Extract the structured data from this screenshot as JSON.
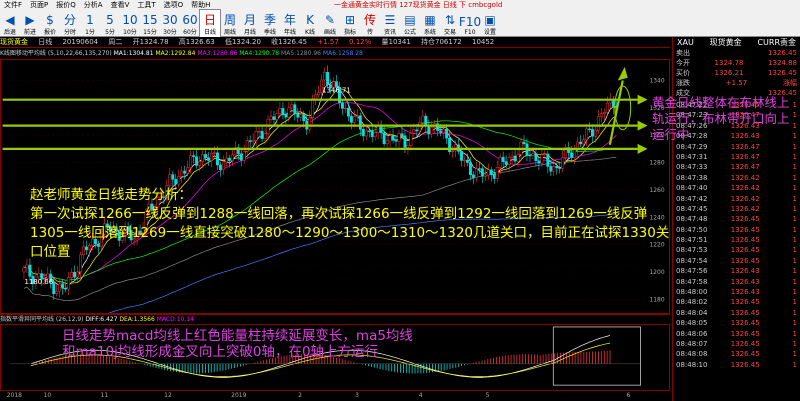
{
  "menu": [
    "文件F",
    "页面P",
    "报价Q",
    "分析A",
    "查看V",
    "工具T",
    "选项O",
    "帮助H"
  ],
  "window_title": "一金通黄金实时行情 127现货黄金 日线 下 cmbcgold",
  "toolbar": [
    {
      "glyph": "◀",
      "label": "后退"
    },
    {
      "glyph": "▶",
      "label": "前进"
    },
    {
      "glyph": "$",
      "label": "报价"
    },
    {
      "glyph": "分",
      "label": "分时"
    },
    {
      "glyph": "1",
      "label": "1分"
    },
    {
      "glyph": "5",
      "label": "5分"
    },
    {
      "glyph": "10",
      "label": "10分"
    },
    {
      "glyph": "15",
      "label": "15分"
    },
    {
      "glyph": "30",
      "label": "30分"
    },
    {
      "glyph": "60",
      "label": "60分"
    },
    {
      "glyph": "日",
      "label": "日线"
    },
    {
      "glyph": "周",
      "label": "周线"
    },
    {
      "glyph": "月",
      "label": "月线"
    },
    {
      "glyph": "季",
      "label": "季线"
    },
    {
      "glyph": "年",
      "label": "年线"
    },
    {
      "glyph": "K",
      "label": "K线"
    },
    {
      "glyph": "✎",
      "label": "画线"
    },
    {
      "glyph": "⊞",
      "label": "指标"
    },
    {
      "glyph": "传",
      "label": "传"
    },
    {
      "glyph": "☰",
      "label": "资讯"
    },
    {
      "glyph": "▤",
      "label": "公式"
    },
    {
      "glyph": "▦",
      "label": "系统"
    },
    {
      "glyph": "⇅",
      "label": "交易"
    },
    {
      "glyph": "F10",
      "label": "F10"
    },
    {
      "glyph": "▣",
      "label": "设置"
    }
  ],
  "chart_header": {
    "symbol": "现货黄金",
    "period": "日线",
    "date": "20190604",
    "weekday": "周二",
    "open": "开1324.78",
    "high": "高1326.63",
    "low": "低1324.20",
    "close": "收1326.45",
    "change": "+1.57",
    "pct": "0.12%",
    "amp": "量10341",
    "hold": "持仓706172",
    "vol2": "10452"
  },
  "indicator_line": {
    "name": "K线图移动平均线 (5,10,22,66,135,270)",
    "ma1": "MA1:1304.81",
    "ma2": "MA2:1292.84",
    "ma3": "MA3:1280.86",
    "ma4": "MA4:1290.78",
    "ma5": "MA5:1280.96",
    "ma6": "MA6:1258.28"
  },
  "price_labels": {
    "high_mark": "1346.71",
    "low_mark": "1180.66"
  },
  "price_axis": [
    "1340",
    "1320",
    "1300",
    "1280",
    "1260",
    "1240",
    "1220",
    "1200",
    "1180"
  ],
  "macd_header": {
    "name": "指数平滑异同平均线 (26,12,9)",
    "diff": "DIFF:6.427",
    "dea": "DEA:1.3566",
    "macd": "MACD:10.14"
  },
  "date_axis": [
    {
      "label": "2018",
      "pos": 0.01
    },
    {
      "label": "10",
      "pos": 0.065
    },
    {
      "label": "11",
      "pos": 0.15
    },
    {
      "label": "12",
      "pos": 0.245
    },
    {
      "label": "2019",
      "pos": 0.345
    },
    {
      "label": "2",
      "pos": 0.445
    },
    {
      "label": "3",
      "pos": 0.53
    },
    {
      "label": "4",
      "pos": 0.625
    },
    {
      "label": "5",
      "pos": 0.725
    },
    {
      "label": "6",
      "pos": 0.935
    }
  ],
  "side_panel": {
    "symbol": "XAU",
    "name": "现货黄金",
    "currency": "CURR责金",
    "rows": [
      {
        "label": "卖出",
        "value": "1326.45",
        "cls": "red"
      },
      {
        "label": "今开",
        "value": "1324.78",
        "extra": "1324.88"
      },
      {
        "label": "买价",
        "value": "1326.21",
        "extra": "1326.45"
      },
      {
        "label": "涨跌",
        "value": "+1.57",
        "extra": "涨幅"
      },
      {
        "label": "成交",
        "value": "1326.45"
      }
    ],
    "ticks": [
      {
        "time": "08:47:22",
        "price": "1326.45",
        "vol": "1"
      },
      {
        "time": "08:47:23",
        "price": "1326.47",
        "vol": "1"
      },
      {
        "time": "08:47:26",
        "price": "1326.43",
        "vol": "1"
      },
      {
        "time": "08:47:28",
        "price": "1326.43",
        "vol": "1"
      },
      {
        "time": "08:47:29",
        "price": "1326.47",
        "vol": "1"
      },
      {
        "time": "08:47:31",
        "price": "1326.47",
        "vol": "1"
      },
      {
        "time": "08:47:33",
        "price": "1326.47",
        "vol": "1"
      },
      {
        "time": "08:47:38",
        "price": "1326.42",
        "vol": "1"
      },
      {
        "time": "08:47:40",
        "price": "1326.42",
        "vol": "1"
      },
      {
        "time": "08:47:42",
        "price": "1326.42",
        "vol": "1"
      },
      {
        "time": "08:47:45",
        "price": "1326.42",
        "vol": "1"
      },
      {
        "time": "08:47:48",
        "price": "1326.45",
        "vol": "1"
      },
      {
        "time": "08:47:50",
        "price": "1326.45",
        "vol": "1"
      },
      {
        "time": "08:47:51",
        "price": "1326.45",
        "vol": "1"
      },
      {
        "time": "08:47:53",
        "price": "1326.45",
        "vol": "1"
      },
      {
        "time": "08:47:54",
        "price": "1326.45",
        "vol": "1"
      },
      {
        "time": "08:47:56",
        "price": "1326.43",
        "vol": "1"
      },
      {
        "time": "08:47:58",
        "price": "1326.43",
        "vol": "1"
      },
      {
        "time": "08:48:00",
        "price": "1326.43",
        "vol": "1"
      },
      {
        "time": "08:48:02",
        "price": "1326.45",
        "vol": "1"
      },
      {
        "time": "08:48:04",
        "price": "1326.45",
        "vol": "1"
      },
      {
        "time": "08:48:05",
        "price": "1326.45",
        "vol": "1"
      },
      {
        "time": "08:48:06",
        "price": "1326.45",
        "vol": "1"
      },
      {
        "time": "08:48:07",
        "price": "1326.45",
        "vol": "1"
      },
      {
        "time": "08:48:08",
        "price": "1326.45",
        "vol": "1"
      },
      {
        "time": "08:48:10",
        "price": "1326.45",
        "vol": "1"
      }
    ]
  },
  "annotations": {
    "main": "赵老师黄金日线走势分析：\n第一次试探1266一线反弹到1288一线回落，再次试探1266一线反弹到1292一线回落到1269一线反弹1305一线回落到1269一线直接突破1280～1290～1300～1310～1320几道关口，目前正在试探1330关口位置",
    "macd": "日线走势macd均线上红色能量柱持续延展变长，ma5均线和ma10j均线形成金叉向上突破0轴，在0轴上方运行",
    "right": "黄金日线整体在布林线上轨运行，布林带开口向上运行中"
  },
  "colors": {
    "up": "#ff3030",
    "down": "#00e0e0",
    "accent": "#ff0",
    "support": "#9c0"
  }
}
